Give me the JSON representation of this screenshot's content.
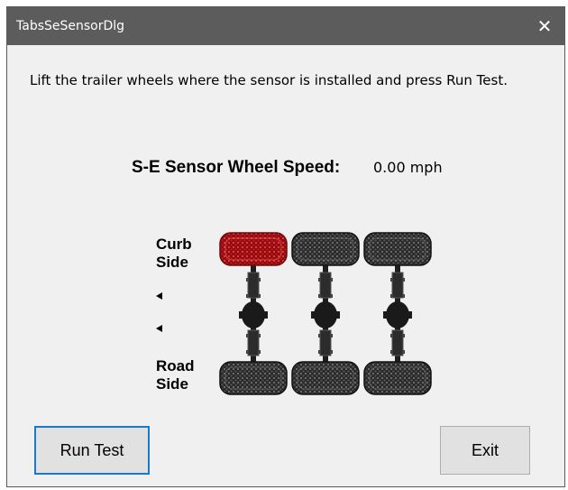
{
  "window": {
    "title": "TabsSeSensorDlg",
    "close_glyph": "✕"
  },
  "instruction": "Lift the trailer wheels where the sensor is installed and press Run Test.",
  "speed": {
    "label": "S-E Sensor Wheel Speed:",
    "value": "0.00 mph"
  },
  "diagram": {
    "curb_label": "Curb\nSide",
    "road_label": "Road\nSide",
    "axle_count": 3,
    "highlighted_wheel": "curb-axle-1",
    "colors": {
      "highlight": "#c8161b",
      "tire": "#2a2a2a"
    }
  },
  "buttons": {
    "run_test": "Run Test",
    "exit": "Exit"
  }
}
